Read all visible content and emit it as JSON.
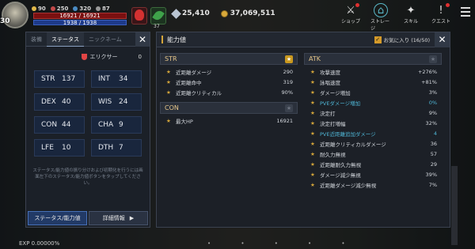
{
  "player": {
    "level": "30",
    "stat1": "90",
    "stat2": "250",
    "stat3": "320",
    "stat4": "87",
    "hp": "16921 / 16921",
    "mp": "1938 / 1938",
    "herb_count": "37"
  },
  "currency": {
    "gems": "25,410",
    "gold": "37,069,511"
  },
  "menu": [
    {
      "label": "ショップ",
      "icon": "gift-icon"
    },
    {
      "label": "ストレージ",
      "icon": "inventory-icon"
    },
    {
      "label": "スキル",
      "icon": "skill-icon"
    },
    {
      "label": "クエスト",
      "icon": "quest-icon"
    }
  ],
  "left": {
    "tabs": [
      "装備",
      "ステータス",
      "ニックネーム"
    ],
    "elixir_label": "エリクサー",
    "elixir_count": "0",
    "stats": [
      {
        "k": "STR",
        "v": "137"
      },
      {
        "k": "INT",
        "v": "34"
      },
      {
        "k": "DEX",
        "v": "40"
      },
      {
        "k": "WIS",
        "v": "24"
      },
      {
        "k": "CON",
        "v": "44"
      },
      {
        "k": "CHA",
        "v": "9"
      },
      {
        "k": "LFE",
        "v": "10"
      },
      {
        "k": "DTH",
        "v": "7"
      }
    ],
    "note": "ステータス/能力値の振り分けおよび初期化を行うには画面左下のステータス/能力値ボタンをタップしてください。",
    "btn_status": "ステータス/能力値",
    "btn_detail": "詳細情報"
  },
  "main": {
    "title": "能力値",
    "fav_label": "お気に入り (16/50)",
    "str_title": "STR",
    "str_rows": [
      {
        "l": "近距離ダメージ",
        "v": "290"
      },
      {
        "l": "近距離命中",
        "v": "319"
      },
      {
        "l": "近距離クリティカル",
        "v": "90%"
      }
    ],
    "con_title": "CON",
    "con_rows": [
      {
        "l": "最大HP",
        "v": "16921"
      }
    ],
    "atk_title": "ATK",
    "atk_rows": [
      {
        "l": "攻撃速度",
        "v": "+276%"
      },
      {
        "l": "詠唱速度",
        "v": "+81%"
      },
      {
        "l": "ダメージ増加",
        "v": "3%"
      },
      {
        "l": "PVEダメージ増加",
        "v": "0%"
      },
      {
        "l": "決定打",
        "v": "9%"
      },
      {
        "l": "決定打増幅",
        "v": "32%"
      },
      {
        "l": "PVE近距離追加ダメージ",
        "v": "4"
      },
      {
        "l": "近距離クリティカルダメージ",
        "v": "36"
      },
      {
        "l": "耐久力無視",
        "v": "57"
      },
      {
        "l": "近距離耐久力無視",
        "v": "29"
      },
      {
        "l": "ダメージ減少無視",
        "v": "39%"
      },
      {
        "l": "近距離ダメージ減少無視",
        "v": "7%"
      }
    ]
  },
  "exp": "EXP 0.00000%"
}
